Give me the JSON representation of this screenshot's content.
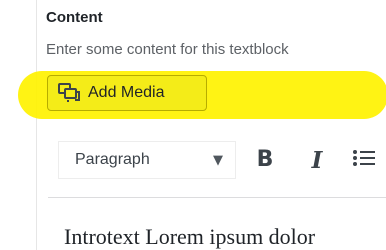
{
  "section": {
    "title": "Content",
    "description": "Enter some content for this textblock"
  },
  "media": {
    "add_media_label": "Add Media",
    "icon": "media-library-icon"
  },
  "toolbar": {
    "format_value": "Paragraph",
    "caret_icon": "caret-down-icon",
    "bold_label": "B",
    "italic_label": "I",
    "list_icon": "bulleted-list-icon"
  },
  "editor": {
    "content_text": "Introtext Lorem ipsum dolor"
  },
  "colors": {
    "highlight": "#fff200",
    "button_bg": "#f4ec18",
    "text": "#1f2328",
    "muted_text": "#5d6166",
    "toolbar_icon": "#3c434a",
    "border": "#dcdcde"
  }
}
